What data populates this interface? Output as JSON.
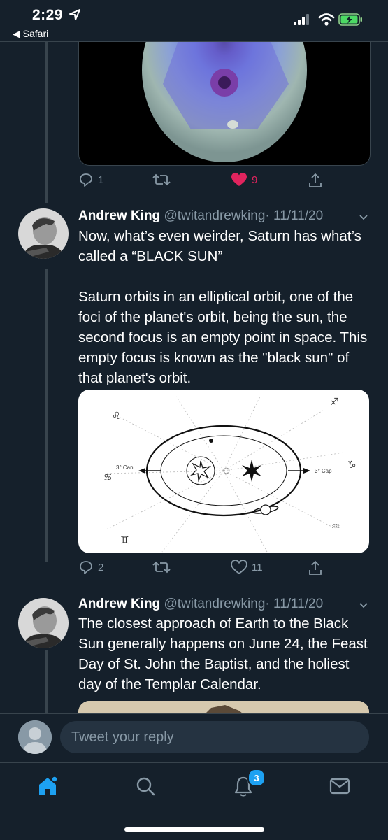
{
  "status_bar": {
    "time": "2:29",
    "back_app": "◀ Safari"
  },
  "tweet0": {
    "reply_count": "1",
    "retweet_count": "",
    "like_count": "9",
    "liked": true
  },
  "tweet1": {
    "name": "Andrew King",
    "handle": "@twitandrewking",
    "date": "· 11/11/20",
    "text": "Now, what’s even weirder, Saturn has what’s called a “BLACK SUN”\n\nSaturn orbits in an elliptical orbit, one of the foci of the planet's orbit, being the sun, the second focus is an empty point in space. This empty focus is known as the \"black sun\" of that planet's orbit.",
    "reply_count": "2",
    "retweet_count": "",
    "like_count": "11",
    "diagram_labels": {
      "left_arrow": "3° Can",
      "right_arrow": "3° Cap"
    }
  },
  "tweet2": {
    "name": "Andrew King",
    "handle": "@twitandrewking",
    "date": "· 11/11/20",
    "text": "The closest approach of Earth to the Black Sun generally happens on June 24, the Feast Day of St. John the Baptist, and the holiest day of the Templar Calendar."
  },
  "reply_bar": {
    "placeholder": "Tweet your reply"
  },
  "bottom_nav": {
    "notification_badge": "3"
  },
  "colors": {
    "background": "#15202b",
    "secondary_text": "#8899a6",
    "like": "#e0245e",
    "accent": "#1da1f2"
  }
}
